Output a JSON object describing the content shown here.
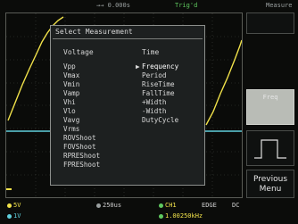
{
  "status_bar": {
    "timebase_marker": "→→ 0.000s",
    "trigger_state": "Trig'd",
    "menu_name": "Measure"
  },
  "dialog": {
    "title": "Select Measurement",
    "voltage_header": "Voltage",
    "time_header": "Time",
    "voltage_items": [
      "Vpp",
      "Vmax",
      "Vmin",
      "Vamp",
      "Vhi",
      "Vlo",
      "Vavg",
      "Vrms",
      "ROVShoot",
      "FOVShoot",
      "RPREShoot",
      "FPREShoot"
    ],
    "time_items": [
      "Frequency",
      "Period",
      "RiseTime",
      "FallTime",
      "+Width",
      "-Width",
      "DutyCycle"
    ],
    "selected_time_item": "Frequency",
    "selected_marker": "▶"
  },
  "menu": {
    "active_item": "Freq",
    "previous_menu_line1": "Previous",
    "previous_menu_line2": "Menu"
  },
  "bottom_bar": {
    "ch1_scale": "5V",
    "ch2_scale": "1V",
    "timebase": "250us",
    "trigger_source": "CH1",
    "trigger_type": "EDGE",
    "coupling": "DC",
    "frequency_readout": "1.00250kHz"
  },
  "colors": {
    "ch1": "#f1e24a",
    "ch2": "#5fd0dc",
    "grid": "#3c3f3a"
  }
}
